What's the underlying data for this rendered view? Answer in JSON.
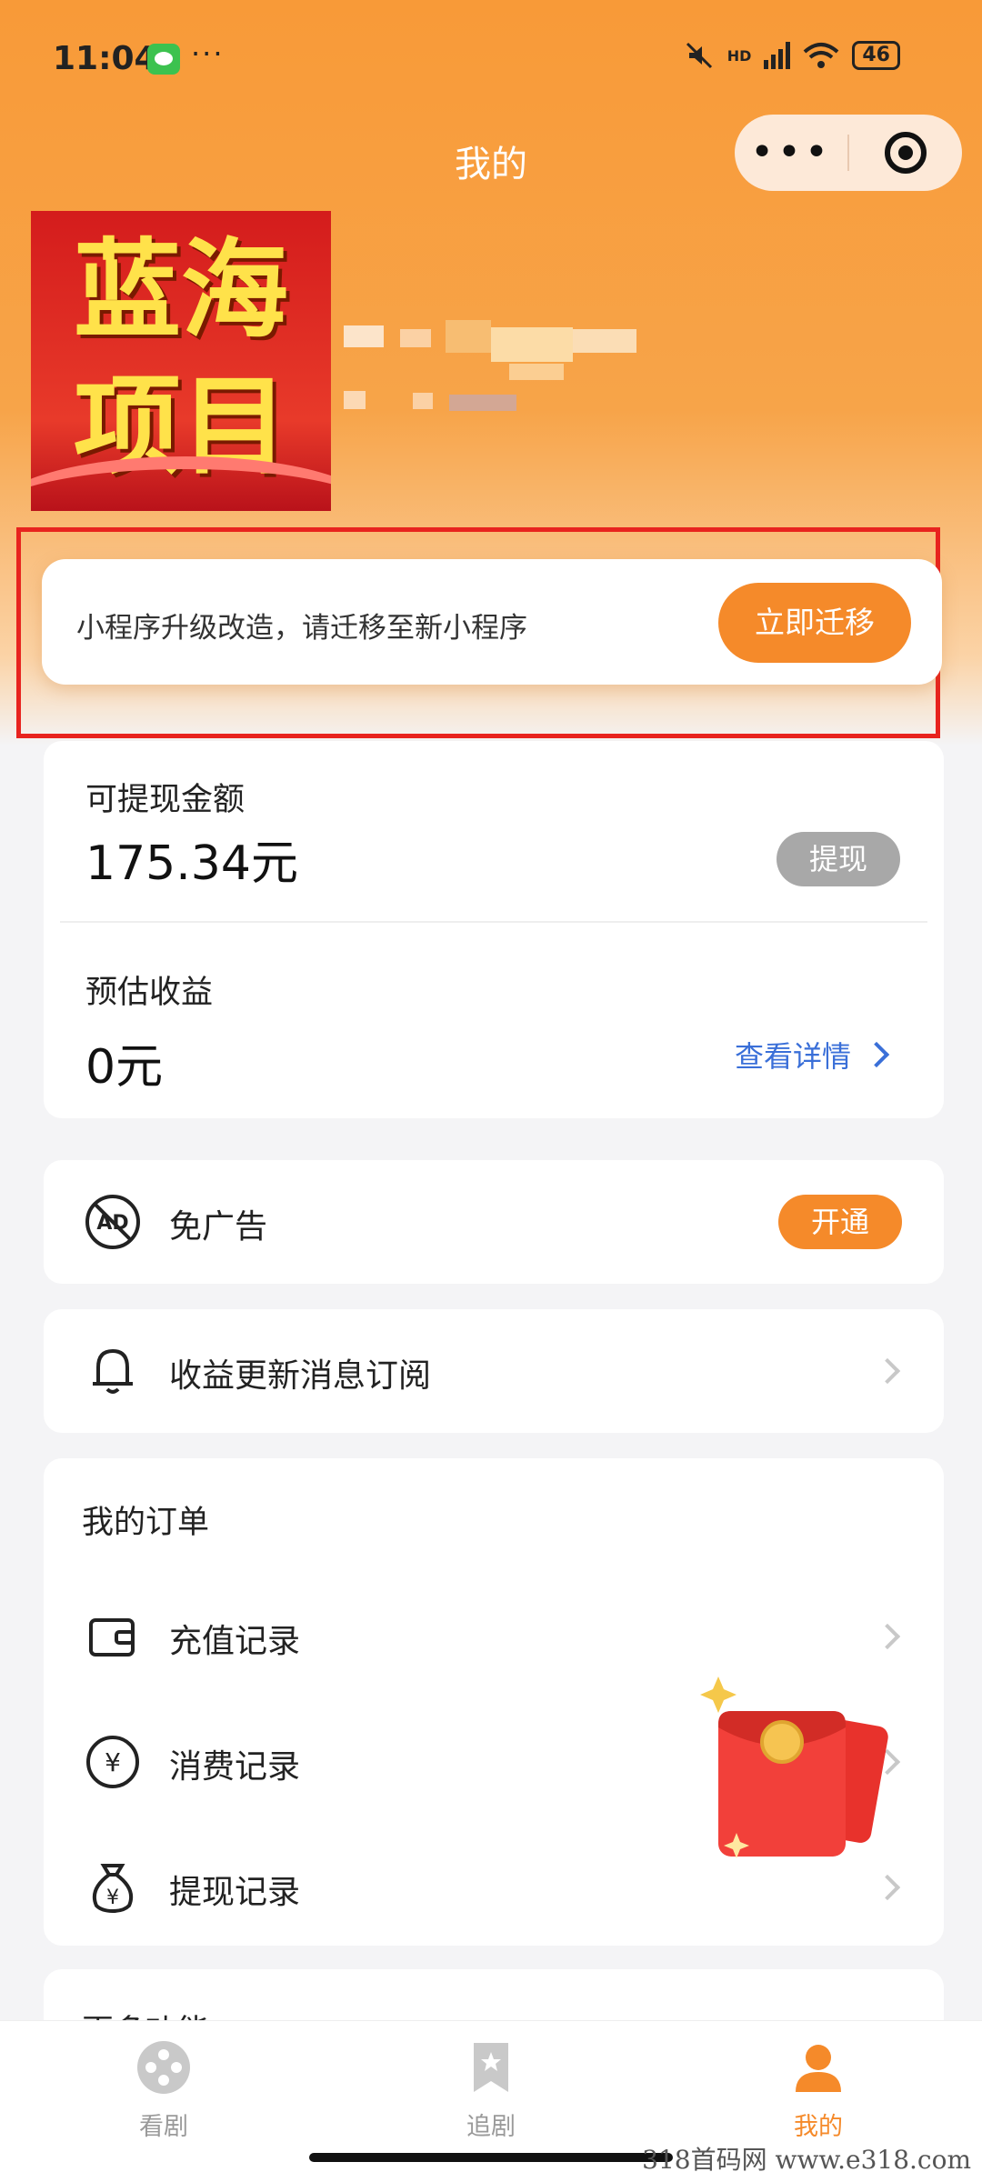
{
  "status_bar": {
    "time": "11:04",
    "more": "···",
    "network": "HD",
    "battery": "46"
  },
  "header": {
    "title": "我的",
    "capsule_more": "•••"
  },
  "avatar": {
    "line1": "蓝海",
    "line2": "项目"
  },
  "migrate": {
    "text": "小程序升级改造，请迁移至新小程序",
    "button": "立即迁移"
  },
  "wallet": {
    "withdrawable_label": "可提现金额",
    "withdrawable_value": "175.34元",
    "withdraw_button": "提现",
    "estimated_label": "预估收益",
    "estimated_value": "0元",
    "details_link": "查看详情"
  },
  "no_ads": {
    "label": "免广告",
    "button": "开通",
    "icon_text": "AD"
  },
  "subscribe": {
    "label": "收益更新消息订阅"
  },
  "orders": {
    "section_title": "我的订单",
    "items": [
      {
        "label": "充值记录",
        "icon": "wallet-icon"
      },
      {
        "label": "消费记录",
        "icon": "yuan-icon"
      },
      {
        "label": "提现记录",
        "icon": "money-bag-icon"
      }
    ]
  },
  "more_section": {
    "title": "更多功能"
  },
  "tabbar": {
    "items": [
      {
        "label": "看剧",
        "icon": "film-reel-icon"
      },
      {
        "label": "追剧",
        "icon": "bookmark-star-icon"
      },
      {
        "label": "我的",
        "icon": "person-icon"
      }
    ],
    "active": "我的"
  },
  "watermark": "318首码网 www.e318.com",
  "colors": {
    "accent": "#f58a2a",
    "header": "#f89a38",
    "link": "#3a6fd8",
    "highlight_border": "#e8231e",
    "disabled_pill": "#a8a8a8"
  }
}
